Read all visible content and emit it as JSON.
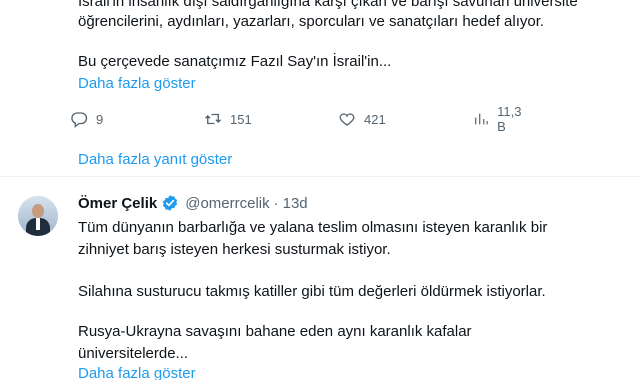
{
  "tweet1": {
    "clipped_line": "İsrail'in insanlık dışı saldırganlığına karşı çıkan ve barışı savunan üniversite",
    "line2": "öğrencilerini, aydınları, yazarları, sporcuları  ve sanatçıları hedef alıyor.",
    "line3": "Bu çerçevede sanatçımız Fazıl Say'ın İsrail'in...",
    "show_more": "Daha fazla göster",
    "actions": {
      "replies": "9",
      "reposts": "151",
      "likes": "421",
      "views": "11,3 B"
    }
  },
  "show_more_replies": "Daha fazla yanıt göster",
  "tweet2": {
    "display_name": "Ömer Çelik",
    "handle": "@omerrcelik",
    "dot": "·",
    "time": "13d",
    "lines": [
      "Tüm dünyanın barbarlığa ve yalana teslim olmasını isteyen karanlık bir",
      "zihniyet barış isteyen herkesi susturmak istiyor.",
      "Silahına susturucu takmış katiller gibi tüm değerleri öldürmek istiyorlar.",
      "Rusya-Ukrayna savaşını bahane eden aynı karanlık kafalar",
      "üniversitelerde..."
    ],
    "show_more": "Daha fazla göster"
  },
  "colors": {
    "link": "#1d9bf0",
    "muted": "#536471",
    "text": "#0f1419",
    "verified": "#1d9bf0"
  },
  "icons": {
    "reply": "reply-icon",
    "repost": "repost-icon",
    "like": "heart-icon",
    "views": "views-icon",
    "verified": "verified-badge-icon"
  }
}
